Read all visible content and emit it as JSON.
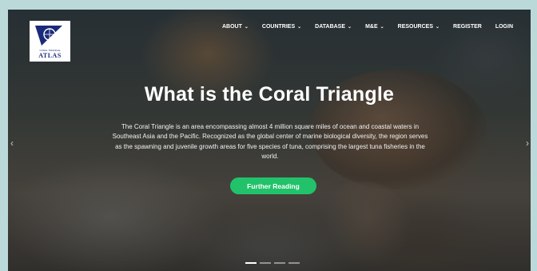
{
  "logo": {
    "name": "ATLAS",
    "subtitle": "CORAL TRIANGLE"
  },
  "nav": {
    "items": [
      {
        "label": "ABOUT",
        "dropdown": true
      },
      {
        "label": "COUNTRIES",
        "dropdown": true
      },
      {
        "label": "DATABASE",
        "dropdown": true
      },
      {
        "label": "M&E",
        "dropdown": true
      },
      {
        "label": "RESOURCES",
        "dropdown": true
      },
      {
        "label": "REGISTER",
        "dropdown": false
      },
      {
        "label": "LOGIN",
        "dropdown": false
      }
    ],
    "caret": "⌄"
  },
  "hero": {
    "title": "What is the Coral Triangle",
    "description": "The Coral Triangle is an area encompassing almost 4 million square miles of ocean and coastal waters in Southeast Asia and the Pacific. Recognized as the global center of marine biological diversity, the region serves as the spawning and juvenile growth areas for five species of tuna, comprising the largest tuna fisheries in the world.",
    "button_label": "Further Reading",
    "prev_arrow": "‹",
    "next_arrow": "›"
  },
  "carousel": {
    "slide_count": 4,
    "active_index": 0
  },
  "colors": {
    "accent": "#21c26a",
    "frame": "#bcd9da",
    "logo_blue": "#1a2a7a"
  }
}
